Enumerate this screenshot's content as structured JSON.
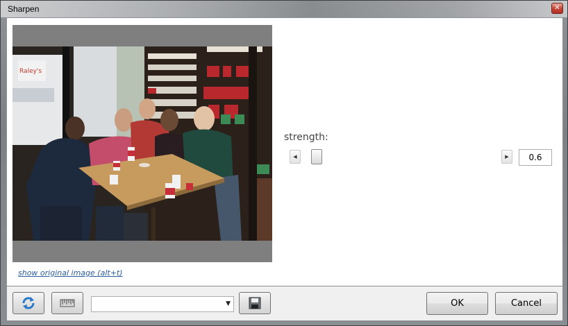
{
  "window": {
    "title": "Sharpen",
    "close_glyph": "✕"
  },
  "preview": {
    "show_original_link": "show original image (alt+t)"
  },
  "strength": {
    "label": "strength:",
    "value": "0.6",
    "level_fraction": 0.06,
    "left_arrow_glyph": "◀",
    "right_arrow_glyph": "▶"
  },
  "toolbar": {
    "refresh_icon": "refresh-icon",
    "ruler_icon": "ruler-icon",
    "preset_value": "",
    "dropdown_glyph": "▼",
    "save_icon": "save-preset-icon"
  },
  "buttons": {
    "ok_label": "OK",
    "cancel_label": "Cancel"
  },
  "colors": {
    "link": "#2a5c9a",
    "close_button": "#c9473a"
  }
}
